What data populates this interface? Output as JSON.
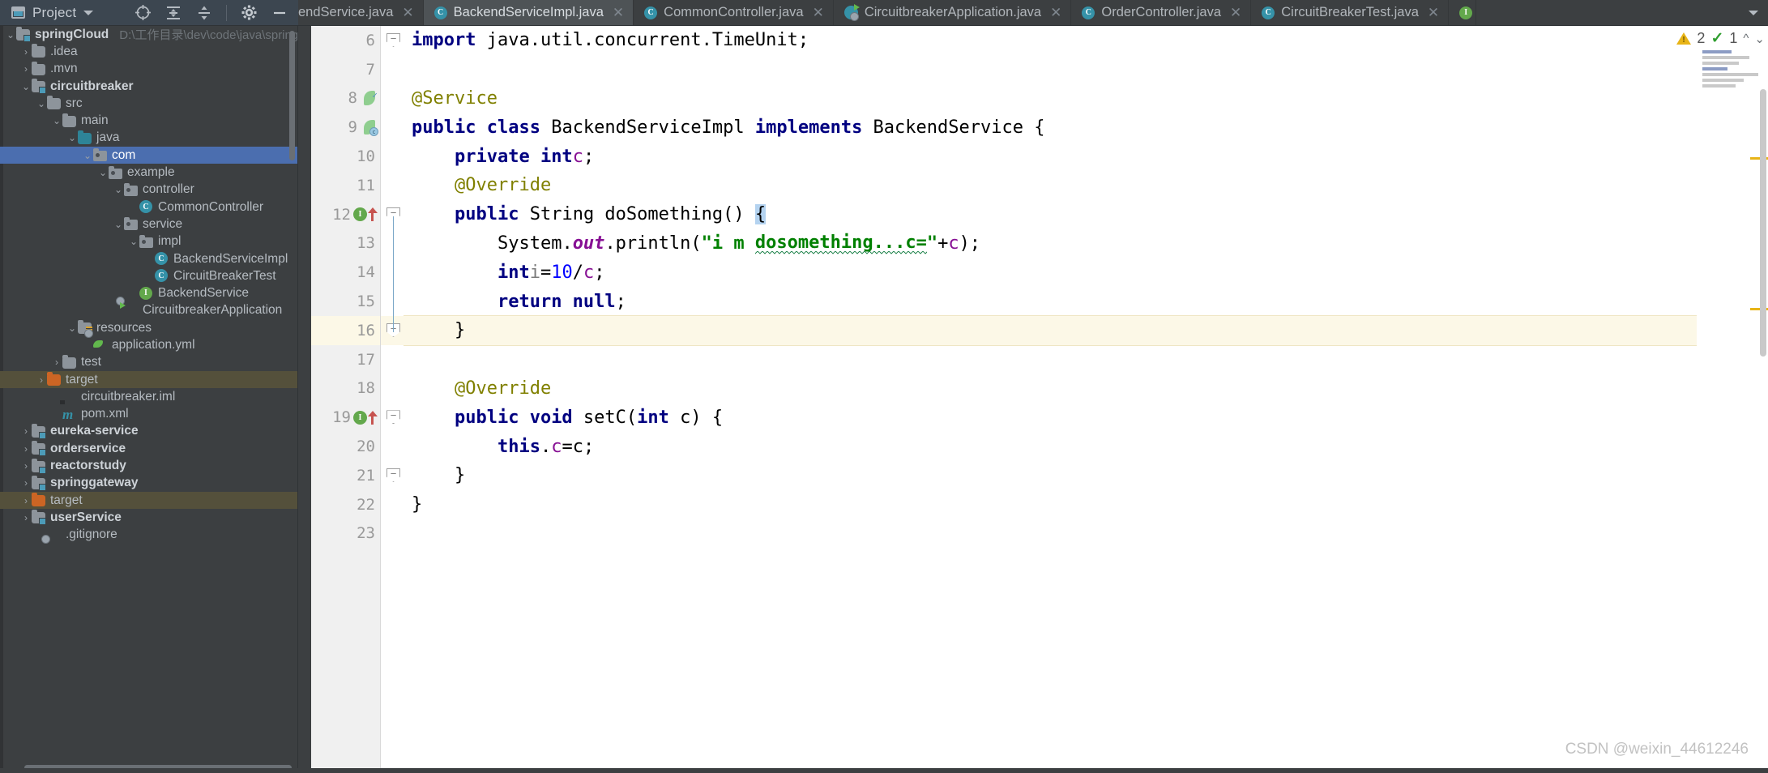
{
  "project_panel": {
    "title": "Project",
    "icons": [
      "locate-icon",
      "expand-all-icon",
      "collapse-all-icon",
      "gear-icon",
      "minimize-icon"
    ]
  },
  "tree": [
    {
      "indent": 0,
      "arrow": "down",
      "icon": "module-folder-icon",
      "label": "springCloud",
      "bold": true,
      "path": "D:\\工作目录\\dev\\code\\java\\springClou"
    },
    {
      "indent": 1,
      "arrow": "right",
      "icon": "folder-icon",
      "label": ".idea",
      "bold": false,
      "path": ""
    },
    {
      "indent": 1,
      "arrow": "right",
      "icon": "folder-icon",
      "label": ".mvn",
      "bold": false,
      "path": ""
    },
    {
      "indent": 1,
      "arrow": "down",
      "icon": "module-folder-icon",
      "label": "circuitbreaker",
      "bold": true,
      "path": ""
    },
    {
      "indent": 2,
      "arrow": "down",
      "icon": "folder-icon",
      "label": "src",
      "bold": false,
      "path": ""
    },
    {
      "indent": 3,
      "arrow": "down",
      "icon": "folder-icon",
      "label": "main",
      "bold": false,
      "path": ""
    },
    {
      "indent": 4,
      "arrow": "down",
      "icon": "source-folder-icon",
      "label": "java",
      "bold": false,
      "path": ""
    },
    {
      "indent": 5,
      "arrow": "down",
      "icon": "package-icon",
      "label": "com",
      "bold": false,
      "path": "",
      "selected": true
    },
    {
      "indent": 6,
      "arrow": "down",
      "icon": "package-icon",
      "label": "example",
      "bold": false,
      "path": ""
    },
    {
      "indent": 7,
      "arrow": "down",
      "icon": "package-icon",
      "label": "controller",
      "bold": false,
      "path": ""
    },
    {
      "indent": 8,
      "arrow": "none",
      "icon": "java-class-icon",
      "label": "CommonController",
      "bold": false,
      "path": ""
    },
    {
      "indent": 7,
      "arrow": "down",
      "icon": "package-icon",
      "label": "service",
      "bold": false,
      "path": ""
    },
    {
      "indent": 8,
      "arrow": "down",
      "icon": "package-icon",
      "label": "impl",
      "bold": false,
      "path": ""
    },
    {
      "indent": 9,
      "arrow": "none",
      "icon": "java-class-icon",
      "label": "BackendServiceImpl",
      "bold": false,
      "path": ""
    },
    {
      "indent": 9,
      "arrow": "none",
      "icon": "java-class-icon",
      "label": "CircuitBreakerTest",
      "bold": false,
      "path": ""
    },
    {
      "indent": 8,
      "arrow": "none",
      "icon": "java-interface-icon",
      "label": "BackendService",
      "bold": false,
      "path": ""
    },
    {
      "indent": 7,
      "arrow": "none",
      "icon": "spring-boot-icon",
      "label": "CircuitbreakerApplication",
      "bold": false,
      "path": ""
    },
    {
      "indent": 4,
      "arrow": "down",
      "icon": "resources-folder-icon",
      "label": "resources",
      "bold": false,
      "path": ""
    },
    {
      "indent": 5,
      "arrow": "none",
      "icon": "spring-yaml-icon",
      "label": "application.yml",
      "bold": false,
      "path": ""
    },
    {
      "indent": 3,
      "arrow": "right",
      "icon": "folder-icon",
      "label": "test",
      "bold": false,
      "path": ""
    },
    {
      "indent": 2,
      "arrow": "right",
      "icon": "excluded-folder-icon",
      "label": "target",
      "bold": false,
      "path": "",
      "excluded": true
    },
    {
      "indent": 3,
      "arrow": "none",
      "icon": "iml-file-icon",
      "label": "circuitbreaker.iml",
      "bold": false,
      "path": ""
    },
    {
      "indent": 3,
      "arrow": "none",
      "icon": "maven-pom-icon",
      "label": "pom.xml",
      "bold": false,
      "path": ""
    },
    {
      "indent": 1,
      "arrow": "right",
      "icon": "module-folder-icon",
      "label": "eureka-service",
      "bold": true,
      "path": ""
    },
    {
      "indent": 1,
      "arrow": "right",
      "icon": "module-folder-icon",
      "label": "orderservice",
      "bold": true,
      "path": ""
    },
    {
      "indent": 1,
      "arrow": "right",
      "icon": "module-folder-icon",
      "label": "reactorstudy",
      "bold": true,
      "path": ""
    },
    {
      "indent": 1,
      "arrow": "right",
      "icon": "module-folder-icon",
      "label": "springgateway",
      "bold": true,
      "path": ""
    },
    {
      "indent": 1,
      "arrow": "right",
      "icon": "excluded-folder-icon",
      "label": "target",
      "bold": false,
      "path": "",
      "excluded": true
    },
    {
      "indent": 1,
      "arrow": "right",
      "icon": "module-folder-icon",
      "label": "userService",
      "bold": true,
      "path": ""
    },
    {
      "indent": 2,
      "arrow": "none",
      "icon": "gitignore-file-icon",
      "label": ".gitignore",
      "bold": false,
      "path": ""
    }
  ],
  "tabs": [
    {
      "label": "endService.java",
      "icon": "java-interface-icon",
      "active": false,
      "clipped": true
    },
    {
      "label": "BackendServiceImpl.java",
      "icon": "java-class-icon",
      "active": true,
      "clipped": false
    },
    {
      "label": "CommonController.java",
      "icon": "java-class-icon",
      "active": false,
      "clipped": false
    },
    {
      "label": "CircuitbreakerApplication.java",
      "icon": "spring-boot-icon",
      "active": false,
      "clipped": false
    },
    {
      "label": "OrderController.java",
      "icon": "java-class-icon",
      "active": false,
      "clipped": false
    },
    {
      "label": "CircuitBreakerTest.java",
      "icon": "java-class-icon",
      "active": false,
      "clipped": false
    }
  ],
  "editor": {
    "first_line": 6,
    "current_line": 16,
    "lines": [
      {
        "n": 6,
        "text": "import java.util.concurrent.TimeUnit;"
      },
      {
        "n": 7,
        "text": ""
      },
      {
        "n": 8,
        "text": "@Service"
      },
      {
        "n": 9,
        "text": "public class BackendServiceImpl implements BackendService {"
      },
      {
        "n": 10,
        "text": "    private int c;"
      },
      {
        "n": 11,
        "text": "    @Override"
      },
      {
        "n": 12,
        "text": "    public String doSomething() {"
      },
      {
        "n": 13,
        "text": "        System.out.println(\"i m dosomething...c=\"+c);"
      },
      {
        "n": 14,
        "text": "        int i=10/c;"
      },
      {
        "n": 15,
        "text": "        return null;"
      },
      {
        "n": 16,
        "text": "    }"
      },
      {
        "n": 17,
        "text": ""
      },
      {
        "n": 18,
        "text": "    @Override"
      },
      {
        "n": 19,
        "text": "    public void setC(int c) {"
      },
      {
        "n": 20,
        "text": "        this.c=c;"
      },
      {
        "n": 21,
        "text": "    }"
      },
      {
        "n": 22,
        "text": "}"
      },
      {
        "n": 23,
        "text": ""
      }
    ],
    "gutter_markers": [
      {
        "line": 8,
        "icon": "spring-bean-icon"
      },
      {
        "line": 9,
        "icon": "spring-bean-class-icon"
      },
      {
        "line": 12,
        "icon": "implementing-method-icon"
      },
      {
        "line": 19,
        "icon": "implementing-method-icon"
      }
    ]
  },
  "inspection": {
    "warning_icon": "warning-triangle-icon",
    "warning_count": "2",
    "ok_icon": "inspection-ok-icon",
    "ok_count": "1",
    "prev_icon": "chevron-up-icon",
    "next_icon": "chevron-down-icon"
  },
  "watermark": "CSDN @weixin_44612246",
  "colors": {
    "selection_blue": "#4b6eaf",
    "excluded_olive": "#54503b",
    "keyword_navy": "#000080",
    "annotation_olive": "#808000",
    "string_green": "#008000",
    "field_purple": "#871094",
    "number_blue": "#0000ff",
    "current_line": "#fcf8e7",
    "warning_yellow": "#e8b416"
  }
}
